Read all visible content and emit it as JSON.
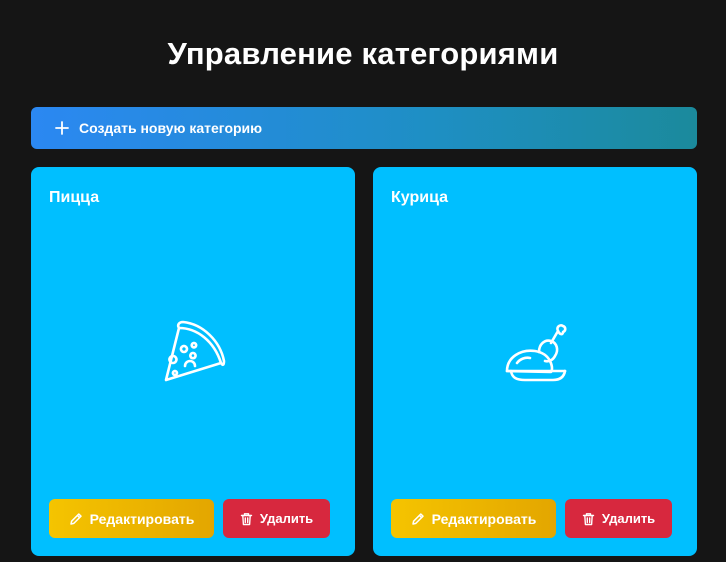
{
  "header": {
    "title": "Управление категориями"
  },
  "toolbar": {
    "create_label": "Создать новую категорию",
    "create_icon": "plus-icon"
  },
  "categories": [
    {
      "title": "Пицца",
      "icon": "pizza-icon",
      "edit_label": "Редактировать",
      "delete_label": "Удалить"
    },
    {
      "title": "Курица",
      "icon": "chicken-icon",
      "edit_label": "Редактировать",
      "delete_label": "Удалить"
    }
  ],
  "colors": {
    "background": "#151515",
    "card": "#00bfff",
    "create_gradient_start": "#2b88f2",
    "create_gradient_end": "#1b8a9c",
    "edit_button": "#f0b800",
    "delete_button": "#d7283e"
  }
}
